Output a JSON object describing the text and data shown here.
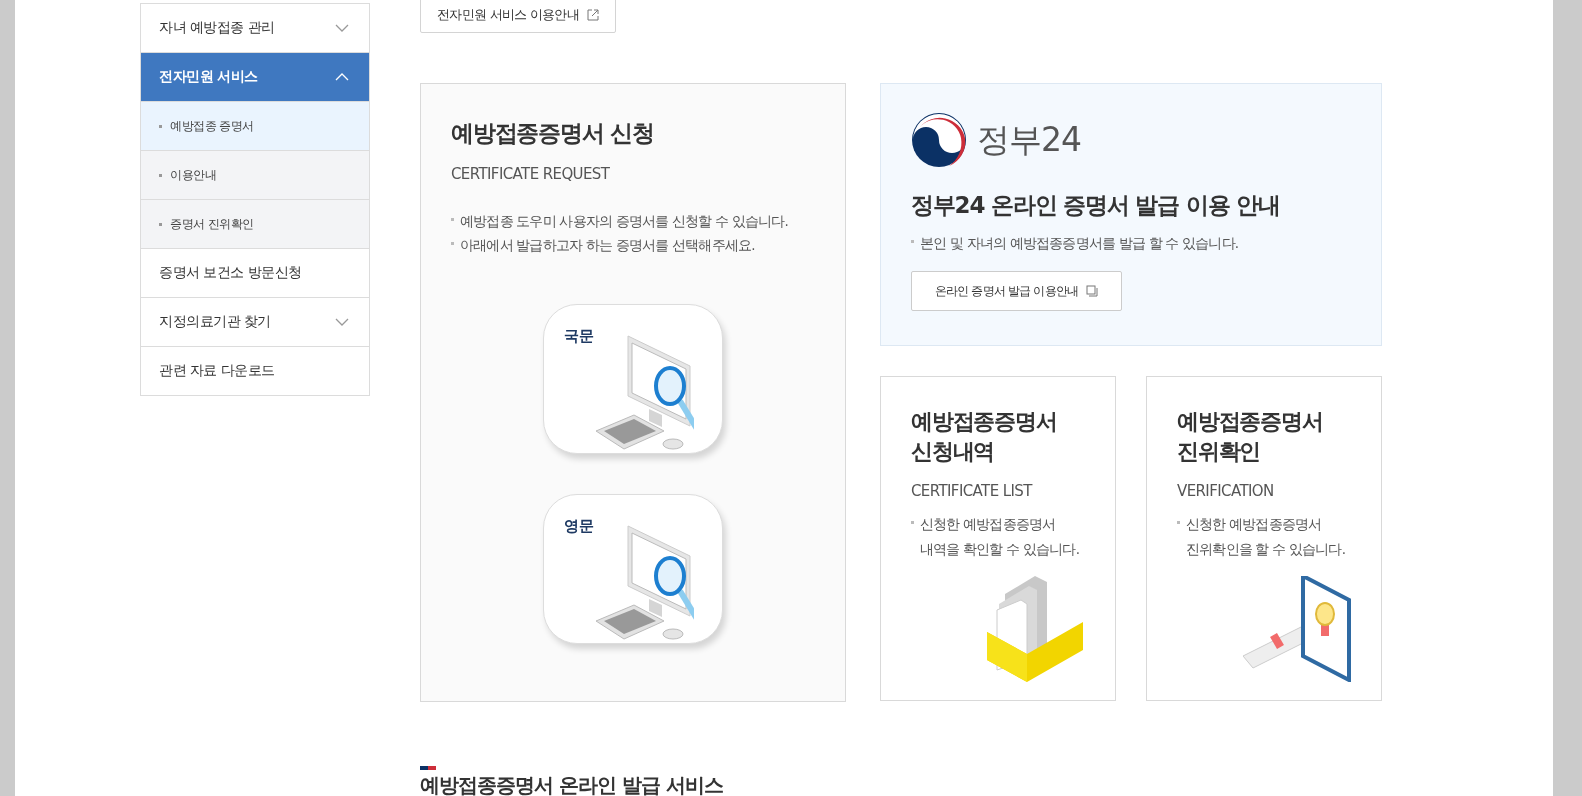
{
  "sidebar": {
    "items": [
      {
        "kind": "group",
        "label": "자녀 예방접종 관리",
        "expanded": false,
        "selected": false
      },
      {
        "kind": "group",
        "label": "전자민원 서비스",
        "expanded": true,
        "selected": true,
        "children": [
          {
            "label": "예방접종 증명서",
            "selected": true
          },
          {
            "label": "이용안내",
            "selected": false
          },
          {
            "label": "증명서 진위확인",
            "selected": false
          }
        ]
      },
      {
        "kind": "link",
        "label": "증명서 보건소 방문신청",
        "selected": false
      },
      {
        "kind": "group",
        "label": "지정의료기관 찾기",
        "expanded": false,
        "selected": false
      },
      {
        "kind": "link",
        "label": "관련 자료 다운로드",
        "selected": false
      }
    ]
  },
  "top_button": "전자민원 서비스 이용안내",
  "request_card": {
    "title": "예방접종증명서 신청",
    "subtitle": "CERTIFICATE REQUEST",
    "bullets": [
      "예방접종 도우미 사용자의 증명서를 신청할 수 있습니다.",
      "아래에서 발급하고자 하는 증명서를 선택해주세요."
    ],
    "options": [
      "국문",
      "영문"
    ]
  },
  "gov24_card": {
    "logo_text": "정부24",
    "title": "정부24 온라인 증명서 발급 이용 안내",
    "bullet": "본인 및 자녀의 예방접종증명서를 발급 할 수 있습니다.",
    "button": "온라인 증명서 발급 이용안내"
  },
  "small_cards": [
    {
      "kind": "list",
      "title_lines": [
        "예방접종증명서",
        "신청내역"
      ],
      "subtitle": "CERTIFICATE LIST",
      "bullet_lines": [
        "신청한 예방접종증명서",
        "내역을 확인할 수 있습니다."
      ]
    },
    {
      "kind": "verify",
      "title_lines": [
        "예방접종증명서",
        "진위확인"
      ],
      "subtitle": "VERIFICATION",
      "bullet_lines": [
        "신청한 예방접종증명서",
        "진위확인을 할 수 있습니다."
      ]
    }
  ],
  "section_heading": "예방접종증명서 온라인 발급 서비스"
}
